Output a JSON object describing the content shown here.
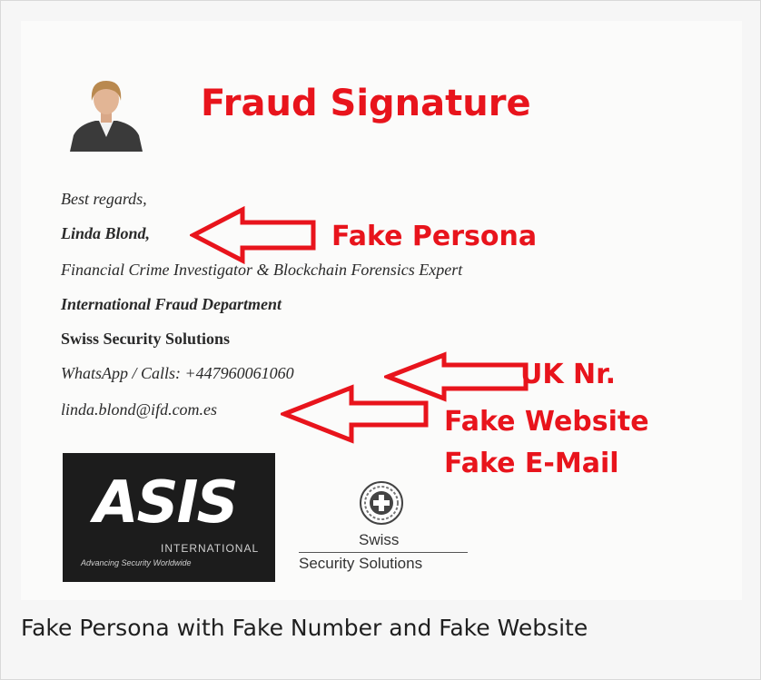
{
  "headline": "Fraud Signature",
  "signature": {
    "greeting": "Best regards,",
    "name": "Linda Blond,",
    "role": "Financial Crime Investigator & Blockchain Forensics Expert",
    "department": "International Fraud Department",
    "company": "Swiss Security Solutions",
    "phone": "WhatsApp / Calls: +447960061060",
    "email": "linda.blond@ifd.com.es"
  },
  "annotations": {
    "persona": "Fake Persona",
    "phone": "UK Nr.",
    "website": "Fake Website",
    "email": "Fake E-Mail"
  },
  "logos": {
    "asis_text": "ASIS",
    "asis_international": "INTERNATIONAL",
    "asis_tagline": "Advancing Security Worldwide",
    "swiss_name": "Swiss",
    "swiss_sub": "Security Solutions"
  },
  "caption": "Fake Persona with Fake Number and Fake Website",
  "colors": {
    "annotation": "#e8141c",
    "background": "#f6f6f6"
  }
}
